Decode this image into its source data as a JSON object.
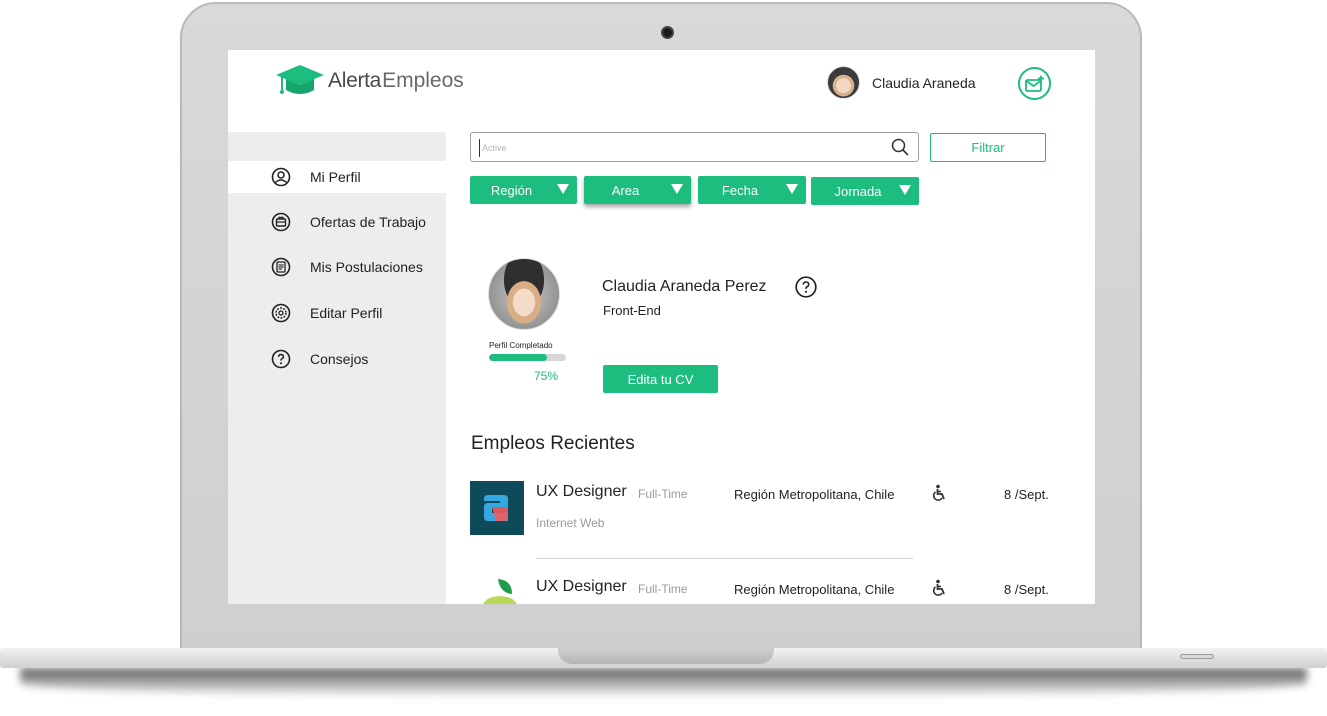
{
  "brand": {
    "word1": "Alerta",
    "word2": "Empleos"
  },
  "user": {
    "name": "Claudia Araneda"
  },
  "sidebar": {
    "items": [
      {
        "label": "Mi Perfil",
        "icon": "user-circle-icon"
      },
      {
        "label": "Ofertas de Trabajo",
        "icon": "briefcase-icon"
      },
      {
        "label": "Mis Postulaciones",
        "icon": "document-icon"
      },
      {
        "label": "Editar Perfil",
        "icon": "gear-icon"
      },
      {
        "label": "Consejos",
        "icon": "help-icon"
      }
    ]
  },
  "search": {
    "placeholder": "Active",
    "value": ""
  },
  "filter_button": "Filtrar",
  "filters": [
    {
      "label": "Región"
    },
    {
      "label": "Area"
    },
    {
      "label": "Fecha"
    },
    {
      "label": "Jornada"
    }
  ],
  "profile": {
    "name": "Claudia Araneda Perez",
    "role": "Front-End",
    "completion_label": "Perfil Completado",
    "completion_percent": 75,
    "completion_text": "75%",
    "edit_cv_label": "Edita tu CV"
  },
  "recent_jobs": {
    "title": "Empleos Recientes",
    "items": [
      {
        "title": "UX Designer",
        "type": "Full-Time",
        "company": "Internet Web",
        "region": "Región Metropolitana, Chile",
        "date": "8 /Sept."
      },
      {
        "title": "UX Designer",
        "type": "Full-Time",
        "company": "",
        "region": "Región Metropolitana, Chile",
        "date": "8 /Sept."
      }
    ]
  },
  "colors": {
    "accent": "#1dbd7f",
    "sidebar_bg": "#efedeb",
    "text": "#222222",
    "muted": "#9a9a9a",
    "logo1_bg": "#0f4a5a"
  }
}
